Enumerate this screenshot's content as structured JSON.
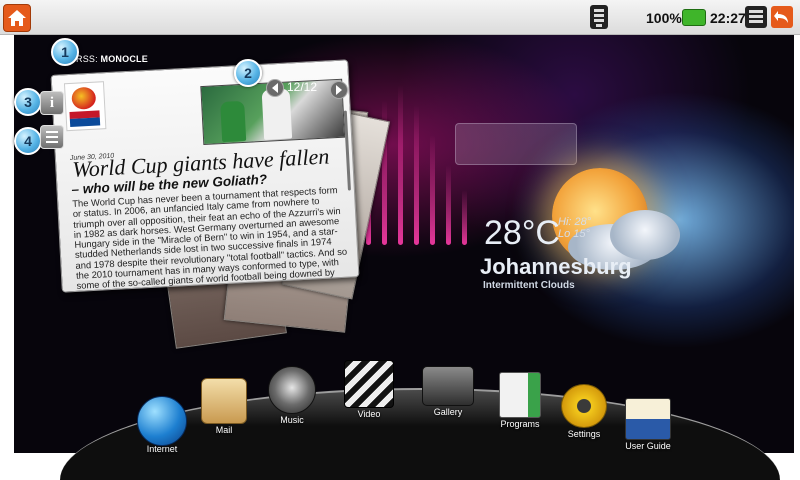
{
  "status_bar": {
    "battery_percent": "100%",
    "time": "22:27"
  },
  "rss": {
    "source_prefix": "RSS:",
    "source_name": "MONOCLE",
    "page_counter": "12/12",
    "article_date": "June 30, 2010",
    "headline": "World Cup giants have fallen",
    "subheadline": "– who will be the new Goliath?",
    "body": "The World Cup has never been a tournament that respects form or status. In 2006, an unfancied Italy came from nowhere to triumph over all opposition, their feat an echo of the Azzurri's win in 1982 as dark horses. West Germany overturned an awesome Hungary side in the \"Miracle of Bern\" to win in 1954, and a star-studded Netherlands side lost in two successive finals in 1974 and 1978 despite their revolutionary \"total football\" tactics. And so the 2010 tournament has in many ways conformed to type, with some of the so-called giants of world football being downed by plucky Davids.",
    "logo_text": "FIFA WORLD CUP SOUTH AFRICA 2010"
  },
  "callouts": [
    "1",
    "2",
    "3",
    "4"
  ],
  "side_buttons": {
    "info_label": "i"
  },
  "weather": {
    "temperature": "28°C",
    "high": "Hi: 28°",
    "low": "Lo 15°",
    "city": "Johannesburg",
    "condition": "Intermittent Clouds"
  },
  "dock": [
    {
      "label": "Internet",
      "icon": "globe-icon"
    },
    {
      "label": "Mail",
      "icon": "envelope-icon"
    },
    {
      "label": "Music",
      "icon": "speaker-icon"
    },
    {
      "label": "Video",
      "icon": "clapper-icon"
    },
    {
      "label": "Gallery",
      "icon": "camera-icon"
    },
    {
      "label": "Programs",
      "icon": "programs-icon"
    },
    {
      "label": "Settings",
      "icon": "gear-icon"
    },
    {
      "label": "User Guide",
      "icon": "books-icon"
    }
  ],
  "colors": {
    "accent_orange": "#e55a1b",
    "battery_green": "#3fb52a",
    "callout_blue": "#56b4e6"
  }
}
